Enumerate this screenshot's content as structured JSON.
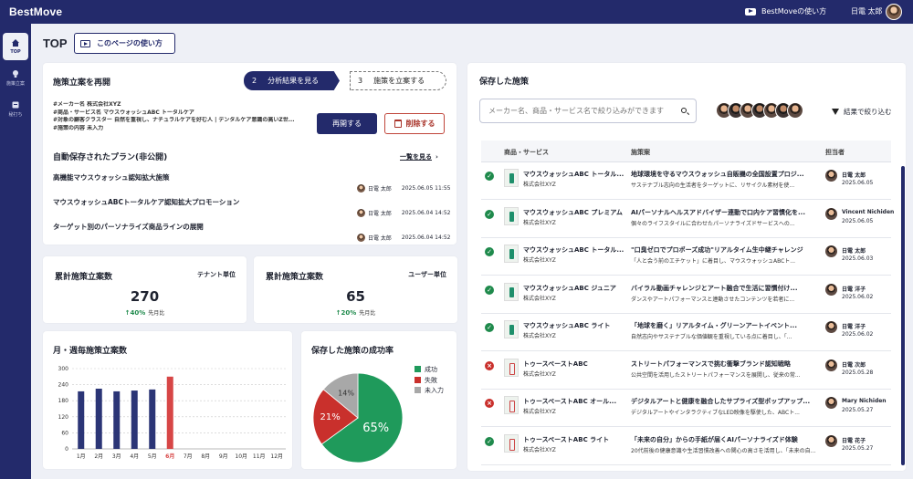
{
  "app": {
    "logo": "BestMove",
    "guide": "BestMoveの使い方",
    "user": "日電 太郎"
  },
  "sidebar": {
    "items": [
      {
        "label": "TOP",
        "icon": "home-icon"
      },
      {
        "label": "施策立案",
        "icon": "lightbulb-icon"
      },
      {
        "label": "秘打ち",
        "icon": "clipboard-icon"
      }
    ]
  },
  "page": {
    "title": "TOP",
    "howto": "このページの使い方"
  },
  "resume": {
    "title": "施策立案を再開",
    "steps": [
      {
        "num": "2",
        "label": "分析結果を見る"
      },
      {
        "num": "3",
        "label": "施策を立案する"
      }
    ],
    "details": [
      "#メーカー名 株式会社XYZ",
      "#商品・サービス名 マウスウォッシュABC トータルケア",
      "#対象の顧客クラスター 自然を重視し、ナチュラルケアを好む人 | デンタルケア意識の高いZ世...",
      "#施策の内容 未入力"
    ],
    "resume_label": "再開する",
    "delete_label": "削除する"
  },
  "autosave": {
    "title": "自動保存されたプラン(非公開)",
    "see_all": "一覧を見る",
    "plans": [
      {
        "name": "高機能マウスウォッシュ認知拡大施策",
        "user": "日電 太郎",
        "date": "2025.06.05 11:55"
      },
      {
        "name": "マウスウォッシュABCトータルケア認知拡大プロモーション",
        "user": "日電 太郎",
        "date": "2025.06.04 14:52"
      },
      {
        "name": "ターゲット別のパーソナライズ商品ラインの展開",
        "user": "日電 太郎",
        "date": "2025.06.04 14:52"
      }
    ]
  },
  "stats": [
    {
      "title": "累計施策立案数",
      "unit": "テナント単位",
      "value": "270",
      "change": "↑40%",
      "sub": "先月比"
    },
    {
      "title": "累計施策立案数",
      "unit": "ユーザー単位",
      "value": "65",
      "change": "↑20%",
      "sub": "先月比"
    }
  ],
  "bar_chart_title": "月・週毎施策立案数",
  "pie_title": "保存した施策の成功率",
  "chart_data": [
    {
      "type": "bar",
      "title": "月・週毎施策立案数",
      "categories": [
        "1月",
        "2月",
        "3月",
        "4月",
        "5月",
        "6月",
        "7月",
        "8月",
        "9月",
        "10月",
        "11月",
        "12月"
      ],
      "values": [
        215,
        225,
        215,
        218,
        222,
        270,
        null,
        null,
        null,
        null,
        null,
        null
      ],
      "ylim": [
        0,
        300
      ],
      "yticks": [
        0,
        60,
        120,
        180,
        240,
        300
      ],
      "highlight_category": "6月",
      "colors": {
        "bar": "#2b3576",
        "highlight": "#d74646"
      }
    },
    {
      "type": "pie",
      "title": "保存した施策の成功率",
      "categories": [
        "成功",
        "失敗",
        "未入力"
      ],
      "values": [
        65,
        21,
        14
      ],
      "labels": [
        "65%",
        "21%",
        "14%"
      ],
      "colors": [
        "#1f9a5b",
        "#c9302c",
        "#a8a8a8"
      ]
    }
  ],
  "saved": {
    "title": "保存した施策",
    "search_placeholder": "メーカー名、商品・サービス名で絞り込みができます",
    "filter_label": "結果で絞り込む",
    "columns": [
      "商品・サービス",
      "施策案",
      "担当者"
    ],
    "rows": [
      {
        "status": "success",
        "product": "マウスウォッシュABC トータル...",
        "company": "株式会社XYZ",
        "measure": "地球環境を守るマウスウォッシュ自販機の全国設置プロジ...",
        "desc": "サステナブル志向の生活者をターゲットに、リサイクル素材を使...",
        "owner": "日電 太郎",
        "date": "2025.06.05"
      },
      {
        "status": "success",
        "product": "マウスウォッシュABC プレミアム",
        "company": "株式会社XYZ",
        "measure": "AIパーソナルヘルスアドバイザー連動で口内ケア習慣化を...",
        "desc": "個々のライフスタイルに合わせたパーソナライズドサービスへの...",
        "owner": "Vincent Nichiden",
        "date": "2025.06.05"
      },
      {
        "status": "success",
        "product": "マウスウォッシュABC トータル...",
        "company": "株式会社XYZ",
        "measure": "\"口臭ゼロでプロポーズ成功\"リアルタイム生中継チャレンジ",
        "desc": "「人と会う前のエチケット」に着目し、マウスウォッシュABCト...",
        "owner": "日電 太郎",
        "date": "2025.06.03"
      },
      {
        "status": "success",
        "product": "マウスウォッシュABC ジュニア",
        "company": "株式会社XYZ",
        "measure": "バイラル動画チャレンジとアート融合で生活に習慣付け...",
        "desc": "ダンスやアートパフォーマンスと連動させたコンテンツを若者に...",
        "owner": "日電 洋子",
        "date": "2025.06.02"
      },
      {
        "status": "success",
        "product": "マウスウォッシュABC ライト",
        "company": "株式会社XYZ",
        "measure": "「地球を磨く」リアルタイム・グリーンアートイベント...",
        "desc": "自然志向やサステナブルな価値観を重視している点に着目し、「...",
        "owner": "日電 洋子",
        "date": "2025.06.02"
      },
      {
        "status": "fail",
        "product": "トゥースペーストABC",
        "company": "株式会社XYZ",
        "measure": "ストリートパフォーマンスで挑む衝撃ブランド認知戦略",
        "desc": "公共空間を活用したストリートパフォーマンスを展開し、従来の常...",
        "owner": "日電 次郎",
        "date": "2025.05.28"
      },
      {
        "status": "fail",
        "product": "トゥースペーストABC オール...",
        "company": "株式会社XYZ",
        "measure": "デジタルアートと健康を融合したサプライズ型ポップアップ...",
        "desc": "デジタルアートやインタラクティブなLED映像を駆使した、ABCト...",
        "owner": "Mary Nichiden",
        "date": "2025.05.27"
      },
      {
        "status": "success",
        "product": "トゥースペーストABC ライト",
        "company": "株式会社XYZ",
        "measure": "「未来の自分」からの手紙が届くAIパーソナライズド体験",
        "desc": "20代前後の健康意識や生活習慣改善への関心の高さを活用し、「未来の自...",
        "owner": "日電 花子",
        "date": "2025.05.27"
      }
    ]
  }
}
